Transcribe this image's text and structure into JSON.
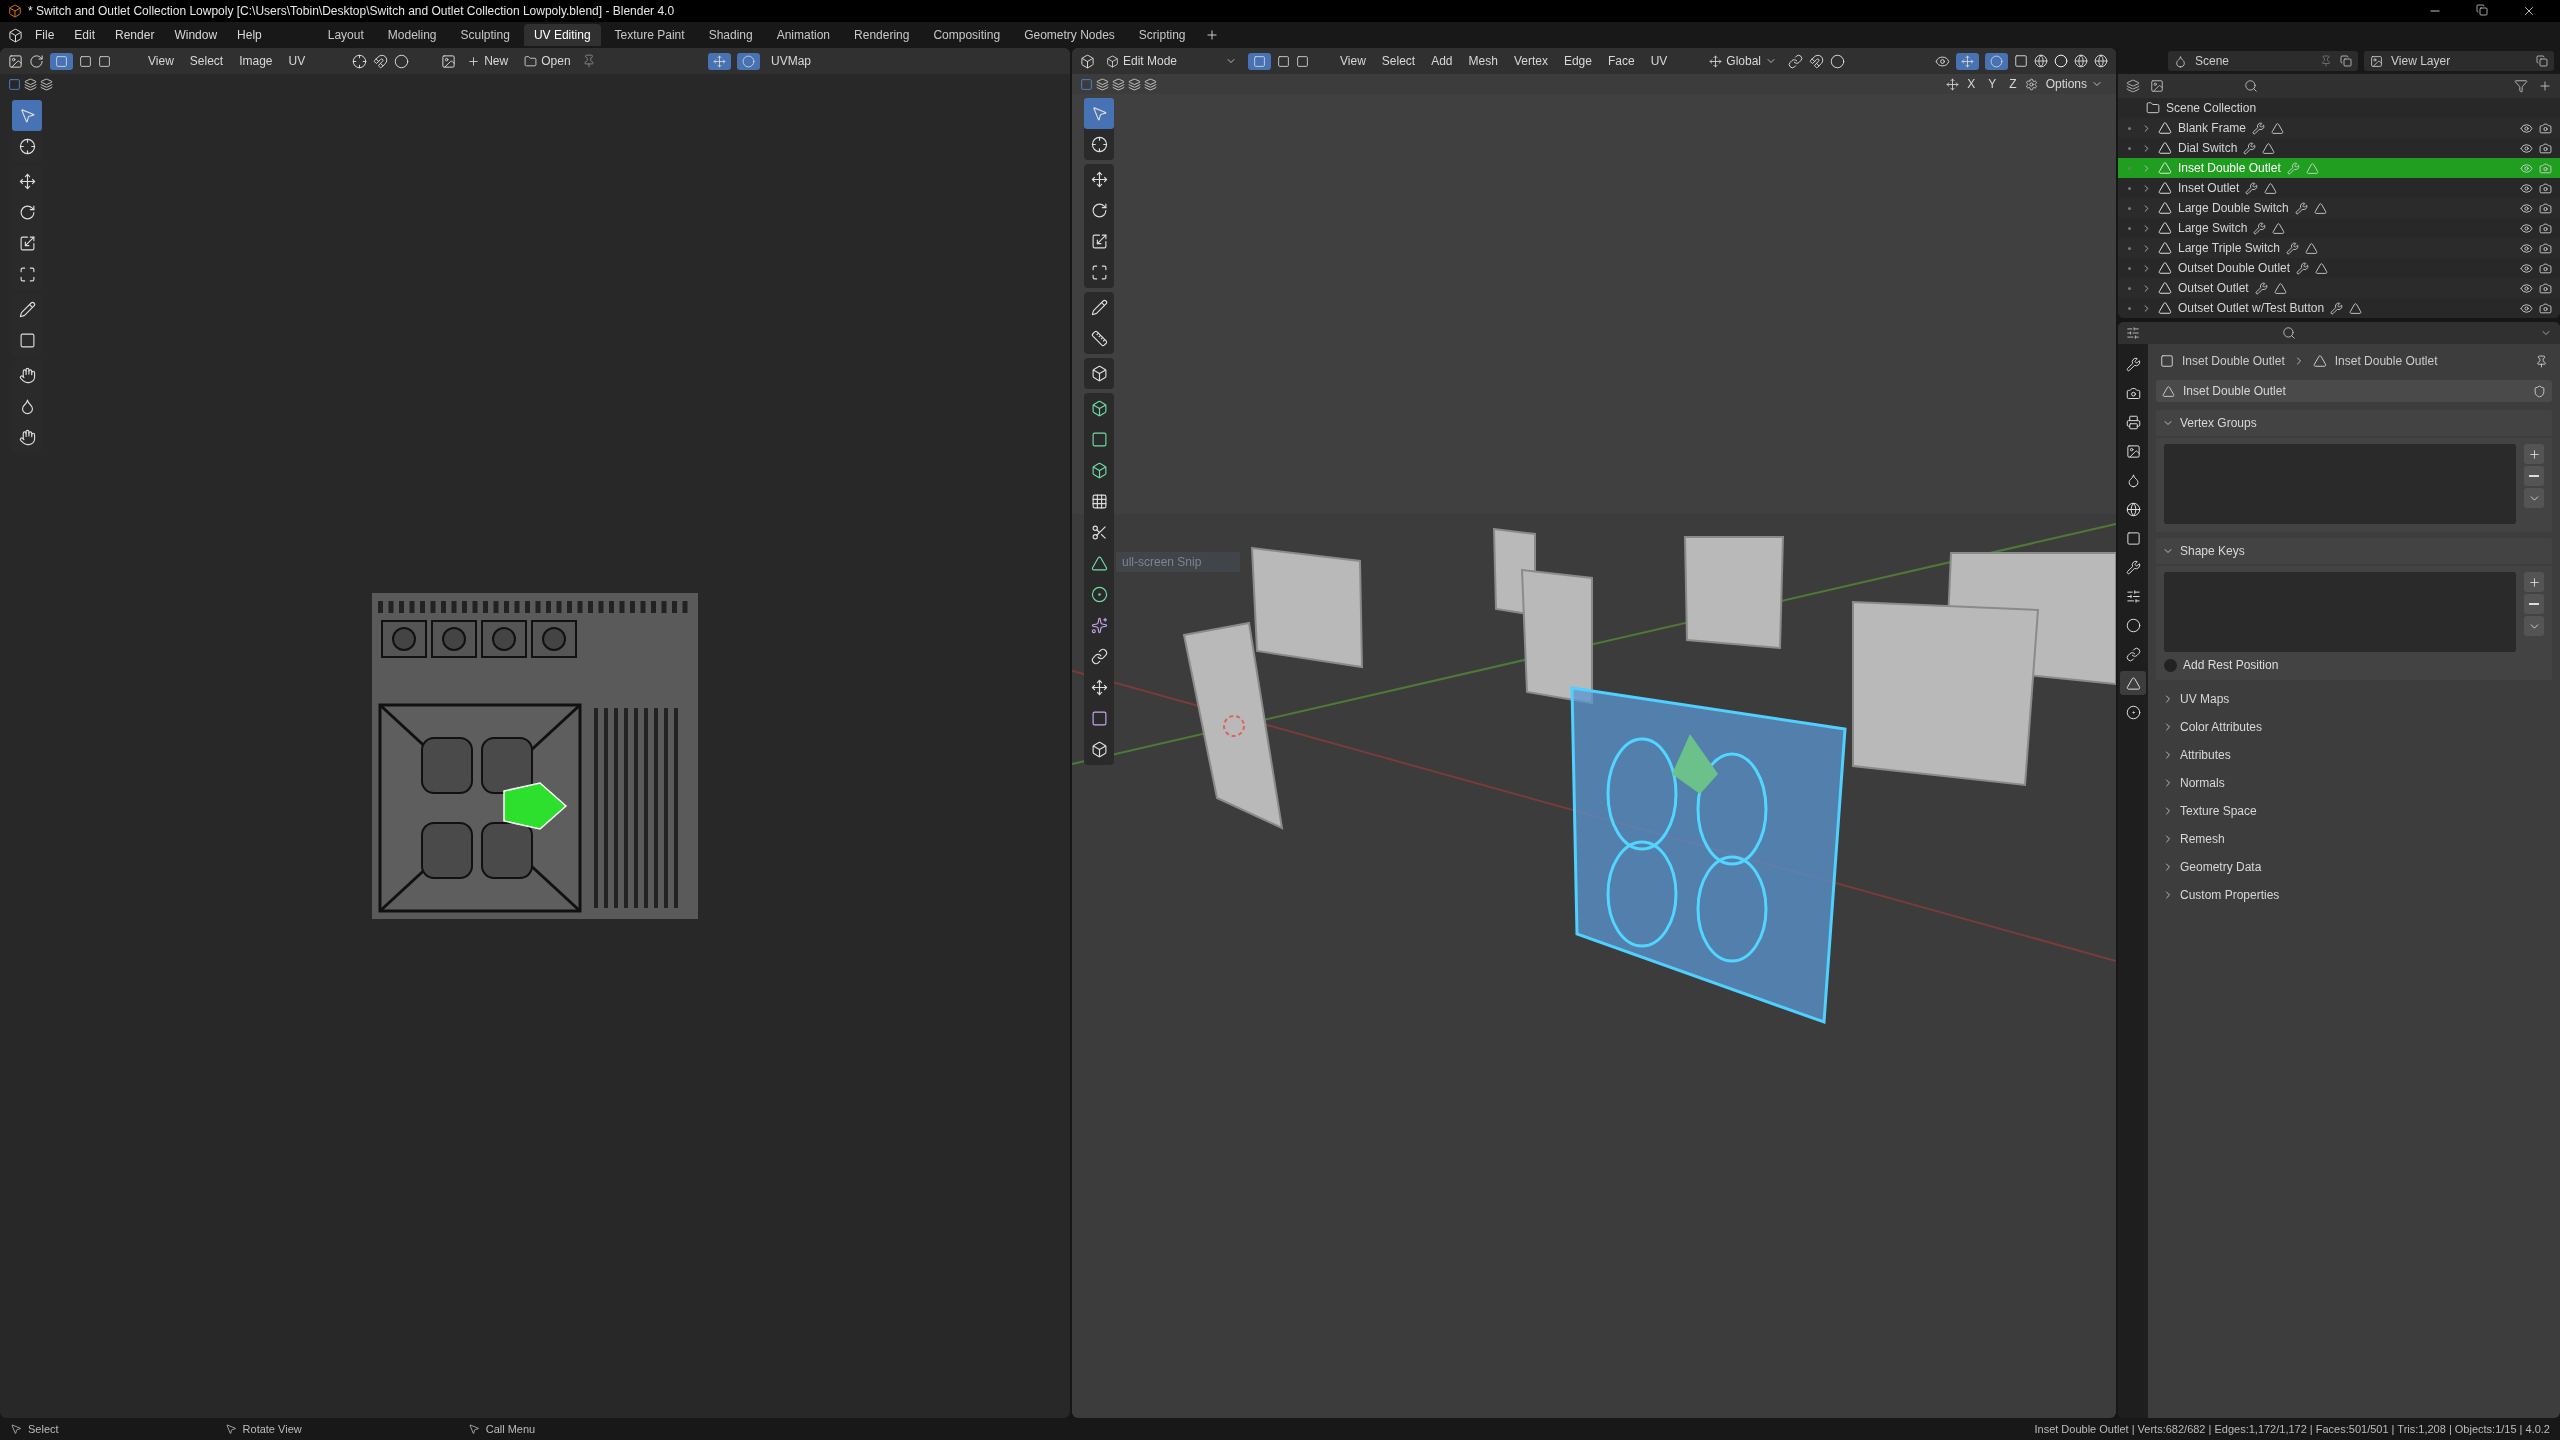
{
  "title_bar": {
    "title": "* Switch and Outlet Collection Lowpoly [C:\\Users\\Tobin\\Desktop\\Switch and Outlet Collection Lowpoly.blend] - Blender 4.0"
  },
  "menu": [
    "File",
    "Edit",
    "Render",
    "Window",
    "Help"
  ],
  "workspaces": [
    {
      "label": "Layout",
      "selected": false
    },
    {
      "label": "Modeling",
      "selected": false
    },
    {
      "label": "Sculpting",
      "selected": false
    },
    {
      "label": "UV Editing",
      "selected": true
    },
    {
      "label": "Texture Paint",
      "selected": false
    },
    {
      "label": "Shading",
      "selected": false
    },
    {
      "label": "Animation",
      "selected": false
    },
    {
      "label": "Rendering",
      "selected": false
    },
    {
      "label": "Compositing",
      "selected": false
    },
    {
      "label": "Geometry Nodes",
      "selected": false
    },
    {
      "label": "Scripting",
      "selected": false
    }
  ],
  "uv_editor": {
    "menus": [
      "View",
      "Select",
      "Image",
      "UV"
    ],
    "new_label": "New",
    "open_label": "Open",
    "uv_map": "UVMap"
  },
  "viewport": {
    "mode": "Edit Mode",
    "menus": [
      "View",
      "Select",
      "Add",
      "Mesh",
      "Vertex",
      "Edge",
      "Face",
      "UV"
    ],
    "orientation": "Global",
    "axes": [
      "X",
      "Y",
      "Z"
    ],
    "options": "Options",
    "tooltip": "ull-screen Snip"
  },
  "outliner": {
    "scene": "Scene",
    "view_layer": "View Layer",
    "root": "Scene Collection",
    "items": [
      {
        "name": "Blank Frame",
        "selected": false
      },
      {
        "name": "Dial Switch",
        "selected": false
      },
      {
        "name": "Inset Double Outlet",
        "selected": true
      },
      {
        "name": "Inset Outlet",
        "selected": false
      },
      {
        "name": "Large Double Switch",
        "selected": false
      },
      {
        "name": "Large Switch",
        "selected": false
      },
      {
        "name": "Large Triple Switch",
        "selected": false
      },
      {
        "name": "Outset Double Outlet",
        "selected": false
      },
      {
        "name": "Outset Outlet",
        "selected": false
      },
      {
        "name": "Outset Outlet w/Test Button",
        "selected": false
      }
    ]
  },
  "properties": {
    "breadcrumb": [
      "Inset Double Outlet",
      "Inset Double Outlet"
    ],
    "mesh_name": "Inset Double Outlet",
    "panels": [
      {
        "title": "Vertex Groups",
        "expanded": true,
        "kind": "list"
      },
      {
        "title": "Shape Keys",
        "expanded": true,
        "kind": "shape_keys"
      },
      {
        "title": "UV Maps",
        "expanded": false
      },
      {
        "title": "Color Attributes",
        "expanded": false
      },
      {
        "title": "Attributes",
        "expanded": false
      },
      {
        "title": "Normals",
        "expanded": false
      },
      {
        "title": "Texture Space",
        "expanded": false
      },
      {
        "title": "Remesh",
        "expanded": false
      },
      {
        "title": "Geometry Data",
        "expanded": false
      },
      {
        "title": "Custom Properties",
        "expanded": false
      }
    ],
    "tabs": [
      {
        "selected": false
      },
      {
        "selected": false
      },
      {
        "selected": false
      },
      {
        "selected": false
      },
      {
        "selected": false
      },
      {
        "selected": false
      },
      {
        "selected": false
      },
      {
        "selected": false
      },
      {
        "selected": false
      },
      {
        "selected": false
      },
      {
        "selected": false
      },
      {
        "selected": true
      },
      {
        "selected": false
      }
    ],
    "rest_position": {
      "label": "Add Rest Position",
      "checked": false
    }
  },
  "status_bar": {
    "hints": [
      "Select",
      "Rotate View",
      "Call Menu"
    ],
    "stats": "Inset Double Outlet | Verts:682/682 | Edges:1,172/1,172 | Faces:501/501 | Tris:1,208 | Objects:1/15 | 4.0.2"
  }
}
